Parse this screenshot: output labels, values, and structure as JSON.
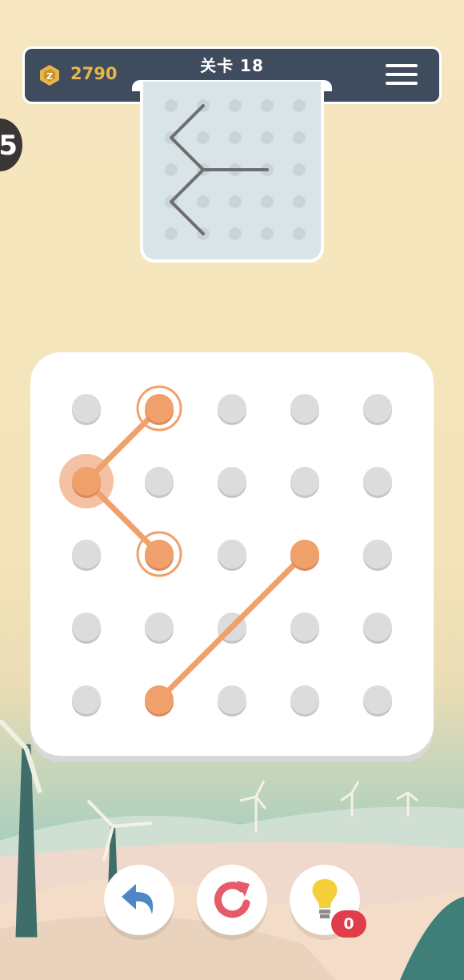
{
  "header": {
    "coins": "2790",
    "level_label": "关卡 18",
    "coin_color": "#e8b54a",
    "bar_color": "#3f4c5e"
  },
  "side_tab": {
    "label": "5"
  },
  "preview": {
    "grid": {
      "rows": 5,
      "cols": 5
    },
    "target_lines": [
      [
        [
          1,
          0
        ],
        [
          0,
          1
        ]
      ],
      [
        [
          0,
          1
        ],
        [
          1,
          2
        ]
      ],
      [
        [
          1,
          2
        ],
        [
          3,
          2
        ]
      ],
      [
        [
          1,
          2
        ],
        [
          0,
          3
        ]
      ],
      [
        [
          0,
          3
        ],
        [
          1,
          4
        ]
      ]
    ],
    "line_color": "#6e6e6e"
  },
  "board": {
    "grid": {
      "rows": 5,
      "cols": 5
    },
    "drawn_lines": [
      [
        [
          1,
          0
        ],
        [
          0,
          1
        ]
      ],
      [
        [
          0,
          1
        ],
        [
          1,
          2
        ]
      ],
      [
        [
          3,
          2
        ],
        [
          1,
          4
        ]
      ]
    ],
    "active_dots": [
      [
        1,
        0
      ],
      [
        0,
        1
      ],
      [
        1,
        2
      ],
      [
        3,
        2
      ],
      [
        1,
        4
      ]
    ],
    "ringed_dots": [
      [
        1,
        0
      ],
      [
        1,
        2
      ]
    ],
    "current_dot": [
      0,
      1
    ],
    "line_color": "#f0a06b",
    "dot_color": "#dcdcdc"
  },
  "controls": {
    "undo_icon": "undo-arrow-icon",
    "restart_icon": "restart-icon",
    "hint_icon": "lightbulb-icon",
    "hint_count": "0"
  }
}
